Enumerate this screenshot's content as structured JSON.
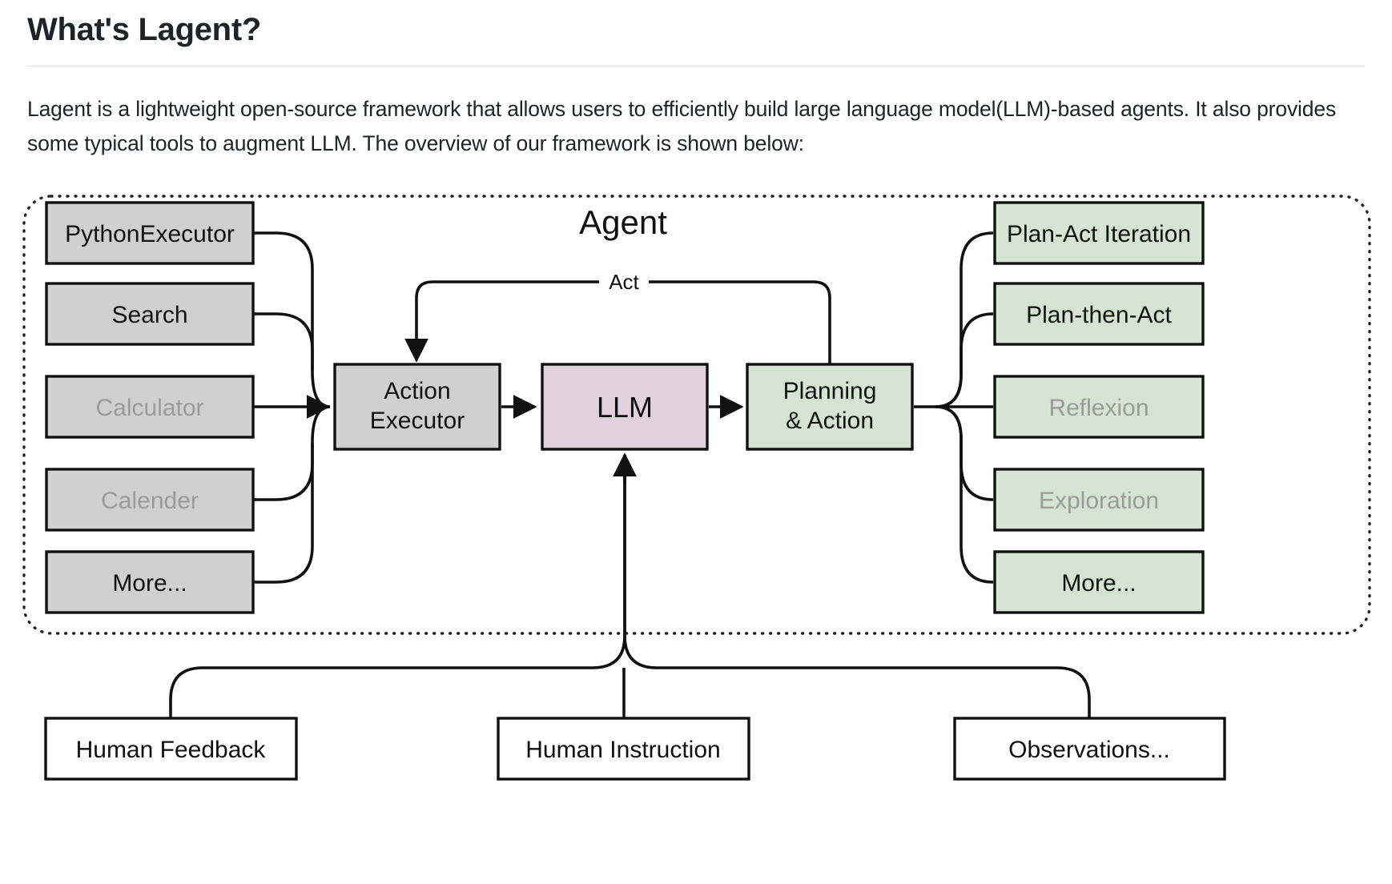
{
  "page": {
    "title": "What's Lagent?",
    "intro": "Lagent is a lightweight open-source framework that allows users to efficiently build large language model(LLM)-based agents. It also provides some typical tools to augment LLM. The overview of our framework is shown below:"
  },
  "diagram": {
    "group_label": "Agent",
    "edge_labels": {
      "act": "Act"
    },
    "colors": {
      "tool_fill": "#d0d0d0",
      "llm_fill": "#e2d0de",
      "planning_fill": "#d6e5d2",
      "plain_fill": "#ffffff",
      "stroke": "#111111",
      "dim_text": "#9b9b9b",
      "text": "#111111",
      "border_dotted": "#222222"
    },
    "tools": [
      {
        "label": "PythonExecutor",
        "dimmed": false
      },
      {
        "label": "Search",
        "dimmed": false
      },
      {
        "label": "Calculator",
        "dimmed": true
      },
      {
        "label": "Calender",
        "dimmed": true
      },
      {
        "label": "More...",
        "dimmed": false
      }
    ],
    "core": [
      {
        "label_line1": "Action",
        "label_line2": "Executor",
        "kind": "tool"
      },
      {
        "label_line1": "LLM",
        "label_line2": "",
        "kind": "llm"
      },
      {
        "label_line1": "Planning",
        "label_line2": "& Action",
        "kind": "planning"
      }
    ],
    "strategies": [
      {
        "label": "Plan-Act Iteration",
        "dimmed": false
      },
      {
        "label": "Plan-then-Act",
        "dimmed": false
      },
      {
        "label": "Reflexion",
        "dimmed": true
      },
      {
        "label": "Exploration",
        "dimmed": true
      },
      {
        "label": "More...",
        "dimmed": false
      }
    ],
    "inputs": [
      {
        "label": "Human Feedback"
      },
      {
        "label": "Human Instruction"
      },
      {
        "label": "Observations..."
      }
    ]
  }
}
